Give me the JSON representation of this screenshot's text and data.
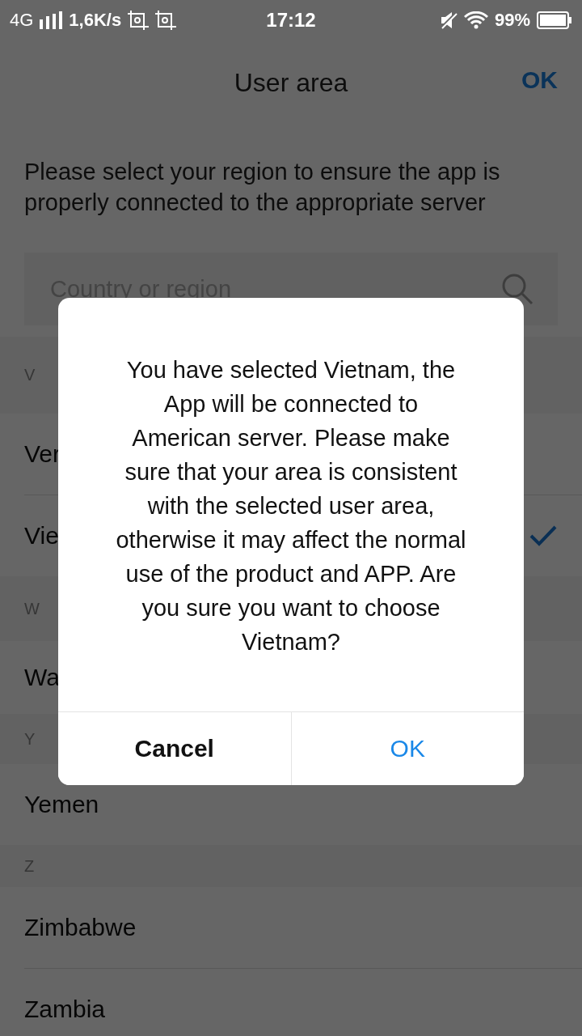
{
  "status_bar": {
    "network": "4G",
    "speed": "1,6K/s",
    "time": "17:12",
    "battery": "99%"
  },
  "header": {
    "title": "User area",
    "action": "OK"
  },
  "description": "Please select your region to ensure the app is properly connected to the appropriate server",
  "search": {
    "placeholder": "Country or region"
  },
  "list": [
    {
      "kind": "header",
      "label": "V"
    },
    {
      "kind": "country",
      "label": "Ver",
      "selected": false
    },
    {
      "kind": "country",
      "label": "Vie",
      "selected": true
    },
    {
      "kind": "header",
      "label": "W"
    },
    {
      "kind": "country",
      "label": "Wa",
      "selected": false
    },
    {
      "kind": "header",
      "label": "Y"
    },
    {
      "kind": "country",
      "label": "Yemen",
      "selected": false
    },
    {
      "kind": "header",
      "label": "Z"
    },
    {
      "kind": "country",
      "label": "Zimbabwe",
      "selected": false
    },
    {
      "kind": "country",
      "label": "Zambia",
      "selected": false
    }
  ],
  "dialog": {
    "message": "You have selected Vietnam, the App will be connected to American server. Please make sure that your area is consistent with the selected user area, otherwise it may affect the normal use of the product and APP. Are you sure you want to choose Vietnam?",
    "buttons": [
      {
        "kind": "cancel",
        "label": "Cancel"
      },
      {
        "kind": "confirm",
        "label": "OK"
      }
    ]
  }
}
